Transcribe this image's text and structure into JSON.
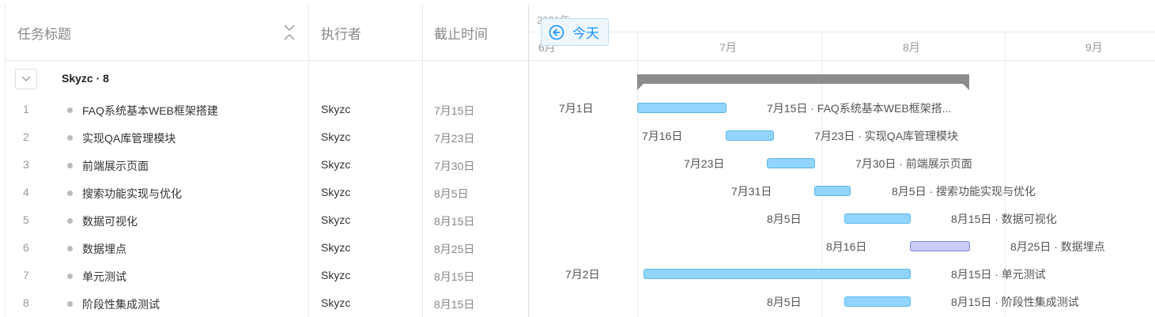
{
  "columns": {
    "title": "任务标题",
    "owner": "执行者",
    "due": "截止时间"
  },
  "group": {
    "name": "Skyzc · 8"
  },
  "tasks": [
    {
      "num": "1",
      "title": "FAQ系统基本WEB框架搭建",
      "owner": "Skyzc",
      "due": "7月15日",
      "start_label": "7月1日",
      "end_label": "7月15日 · FAQ系统基本WEB框架搭..."
    },
    {
      "num": "2",
      "title": "实现QA库管理模块",
      "owner": "Skyzc",
      "due": "7月23日",
      "start_label": "7月16日",
      "end_label": "7月23日 · 实现QA库管理模块"
    },
    {
      "num": "3",
      "title": "前端展示页面",
      "owner": "Skyzc",
      "due": "7月30日",
      "start_label": "7月23日",
      "end_label": "7月30日 · 前端展示页面"
    },
    {
      "num": "4",
      "title": "搜索功能实现与优化",
      "owner": "Skyzc",
      "due": "8月5日",
      "start_label": "7月31日",
      "end_label": "8月5日 · 搜索功能实现与优化"
    },
    {
      "num": "5",
      "title": "数据可视化",
      "owner": "Skyzc",
      "due": "8月15日",
      "start_label": "8月5日",
      "end_label": "8月15日 · 数据可视化"
    },
    {
      "num": "6",
      "title": "数据埋点",
      "owner": "Skyzc",
      "due": "8月25日",
      "start_label": "8月16日",
      "end_label": "8月25日 · 数据埋点"
    },
    {
      "num": "7",
      "title": "单元测试",
      "owner": "Skyzc",
      "due": "8月15日",
      "start_label": "7月2日",
      "end_label": "8月15日 · 单元测试"
    },
    {
      "num": "8",
      "title": "阶段性集成测试",
      "owner": "Skyzc",
      "due": "8月15日",
      "start_label": "8月5日",
      "end_label": "8月15日 · 阶段性集成测试"
    }
  ],
  "timeline": {
    "year": "2021年",
    "months": [
      "6月",
      "7月",
      "8月",
      "9月"
    ],
    "today_label": "今天"
  },
  "colors": {
    "bar": "#91d5ff",
    "bar_alt": "#c9ccf7",
    "summary": "#8c8c8c",
    "accent": "#1890ff"
  },
  "icons": {
    "collapse": "collapse-arrows-icon",
    "toggle": "chevron-down-icon",
    "today": "arrow-left-circle-icon"
  }
}
